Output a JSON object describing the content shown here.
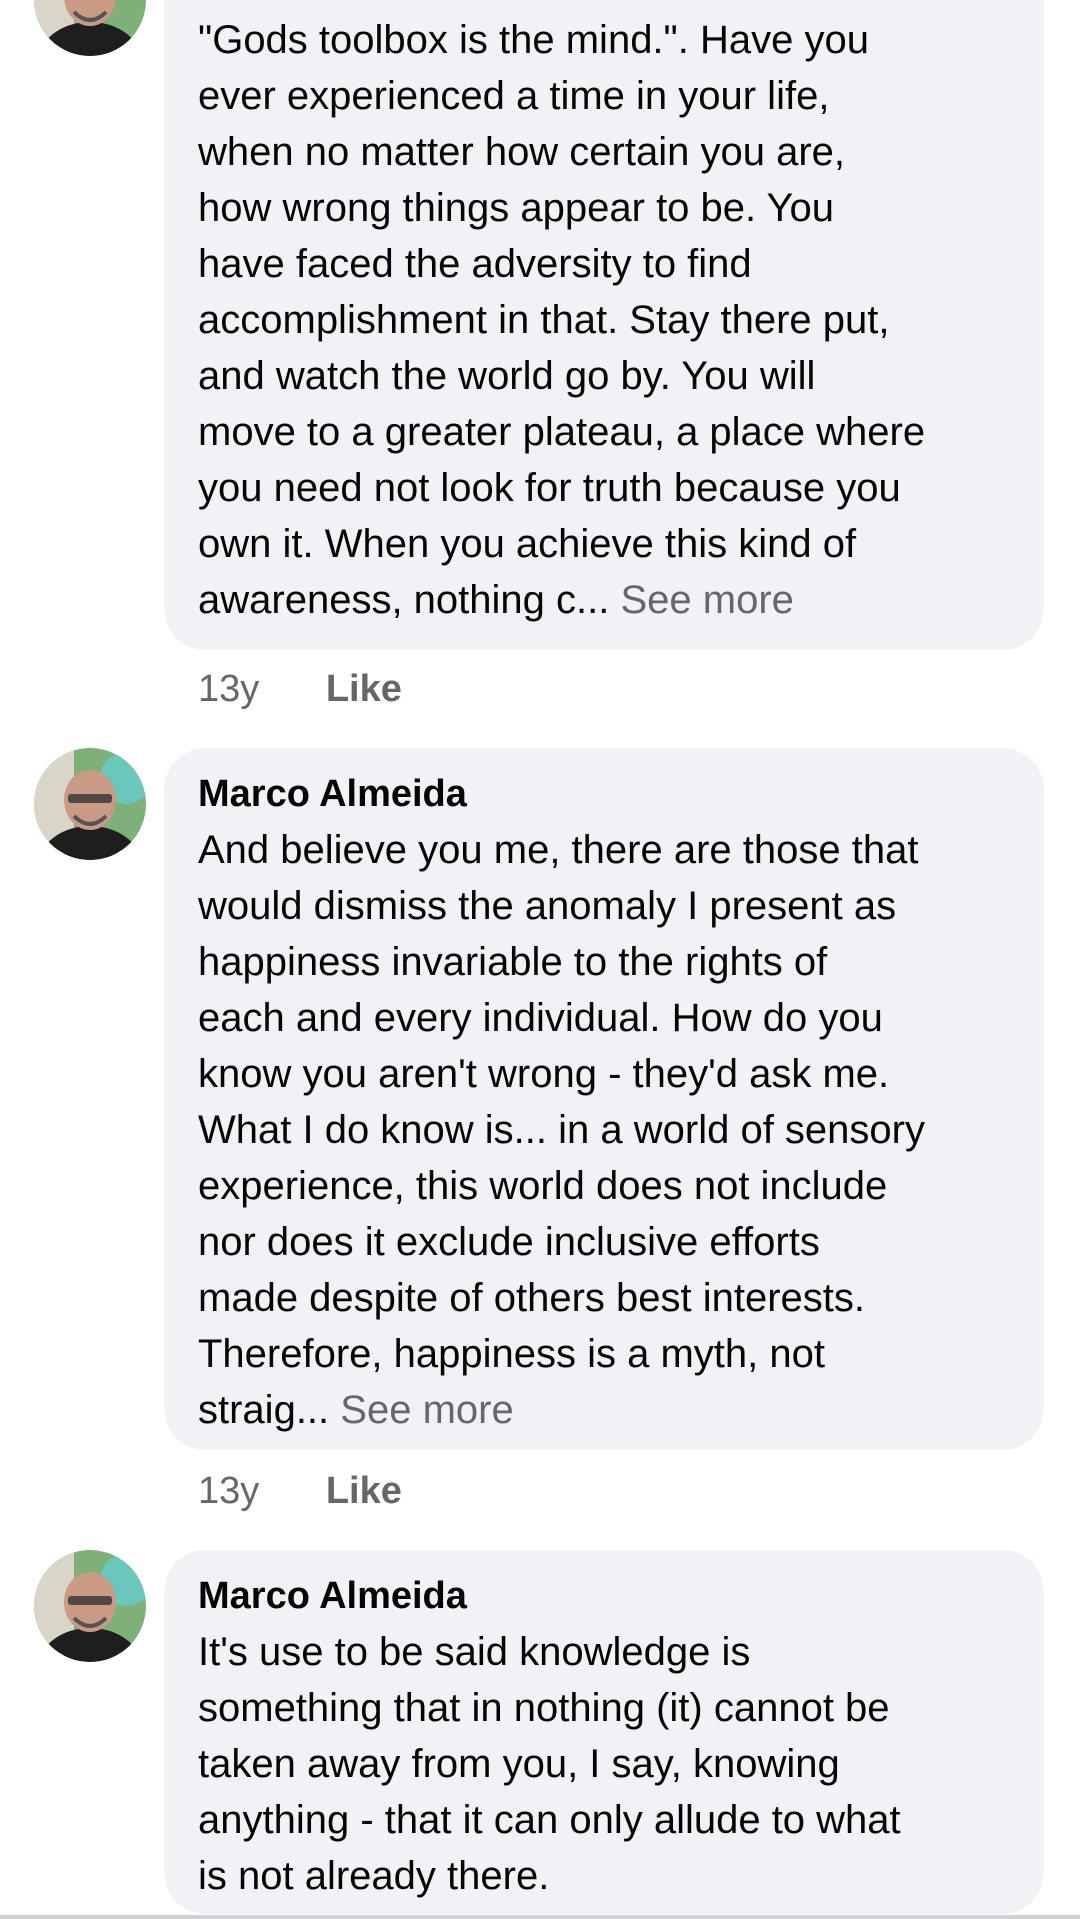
{
  "comments": [
    {
      "author": "",
      "text": "\"Gods toolbox is the mind.\".  Have you\never experienced a time in your life,\nwhen no matter how certain you are,\nhow wrong things appear to be.  You\nhave faced the adversity to find\naccomplishment in that.  Stay there put,\nand watch the world go by.  You will\nmove to a greater plateau, a place where\nyou need not look for truth because you\nown it.  When you achieve this kind of\nawareness, nothing c...",
      "see_more": "See more",
      "time": "13y",
      "like": "Like"
    },
    {
      "author": "Marco Almeida",
      "text": "And believe you me, there are those that\nwould dismiss the anomaly I present as\nhappiness invariable to the rights of\neach and every individual.  How do you\nknow you aren't wrong - they'd ask me.\nWhat I do know is... in a world of sensory\nexperience, this world does not include\nnor does it exclude inclusive efforts\nmade despite of others best interests.\nTherefore, happiness is a myth, not\nstraig...",
      "see_more": "See more",
      "time": "13y",
      "like": "Like"
    },
    {
      "author": "Marco Almeida",
      "text": "It's use to be said knowledge is\nsomething that in nothing (it) cannot be\ntaken away from you, I say, knowing\nanything - that it can only allude to what\nis not already there.",
      "see_more": "",
      "time": "",
      "like": ""
    }
  ],
  "colors": {
    "bubble": "#f0f2f5",
    "text": "#050505",
    "secondary": "#65676b"
  }
}
